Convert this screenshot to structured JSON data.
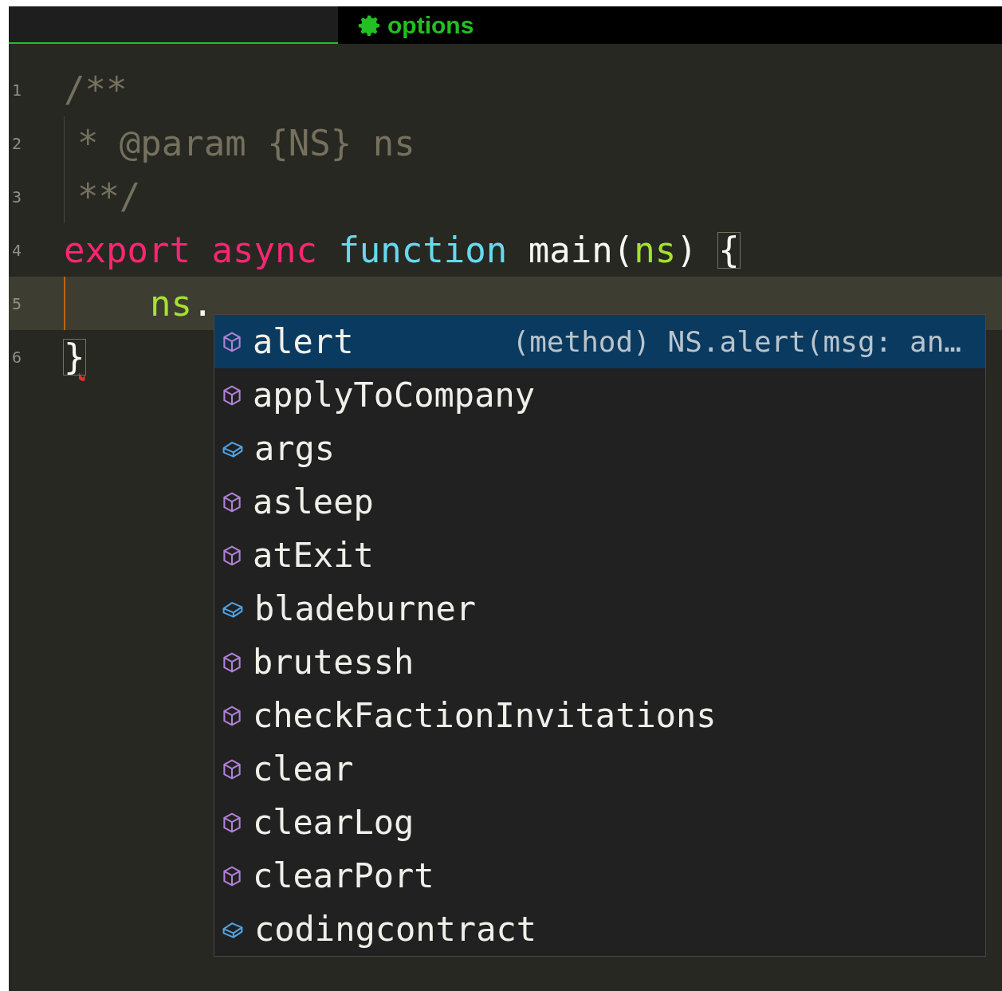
{
  "tab_bar": {
    "options_button": "options"
  },
  "editor": {
    "lines": [
      {
        "number": "1",
        "current": false,
        "guide": false,
        "indented": false,
        "tokens": [
          {
            "text": "/**",
            "kind": "comment"
          }
        ]
      },
      {
        "number": "2",
        "current": false,
        "guide": true,
        "indented": false,
        "tokens": [
          {
            "text": "* @param {NS} ns",
            "kind": "comment"
          }
        ]
      },
      {
        "number": "3",
        "current": false,
        "guide": true,
        "indented": false,
        "tokens": [
          {
            "text": "**/",
            "kind": "comment"
          }
        ]
      },
      {
        "number": "4",
        "current": false,
        "guide": false,
        "indented": false,
        "tokens": [
          {
            "text": "export",
            "kind": "keyword"
          },
          {
            "text": "async",
            "kind": "keyword"
          },
          {
            "text": "function",
            "kind": "storage"
          },
          {
            "text": "main(",
            "kind": "plain"
          },
          {
            "text": "ns",
            "kind": "param"
          },
          {
            "text": ")",
            "kind": "plain"
          },
          {
            "text": "{",
            "kind": "bracket_match"
          }
        ]
      },
      {
        "number": "5",
        "current": true,
        "guide": false,
        "indented": true,
        "tokens": [
          {
            "text": "ns",
            "kind": "param"
          },
          {
            "text": ".",
            "kind": "plain"
          }
        ]
      },
      {
        "number": "6",
        "current": false,
        "guide": false,
        "indented": false,
        "tokens": [
          {
            "text": "}",
            "kind": "bracket_error"
          }
        ]
      }
    ]
  },
  "suggestions": [
    {
      "name": "alert",
      "kind": "method",
      "selected": true,
      "detail": "(method) NS.alert(msg: an…"
    },
    {
      "name": "applyToCompany",
      "kind": "method",
      "selected": false
    },
    {
      "name": "args",
      "kind": "property",
      "selected": false
    },
    {
      "name": "asleep",
      "kind": "method",
      "selected": false
    },
    {
      "name": "atExit",
      "kind": "method",
      "selected": false
    },
    {
      "name": "bladeburner",
      "kind": "property",
      "selected": false
    },
    {
      "name": "brutessh",
      "kind": "method",
      "selected": false
    },
    {
      "name": "checkFactionInvitations",
      "kind": "method",
      "selected": false
    },
    {
      "name": "clear",
      "kind": "method",
      "selected": false
    },
    {
      "name": "clearLog",
      "kind": "method",
      "selected": false
    },
    {
      "name": "clearPort",
      "kind": "method",
      "selected": false
    },
    {
      "name": "codingcontract",
      "kind": "property",
      "selected": false
    }
  ]
}
